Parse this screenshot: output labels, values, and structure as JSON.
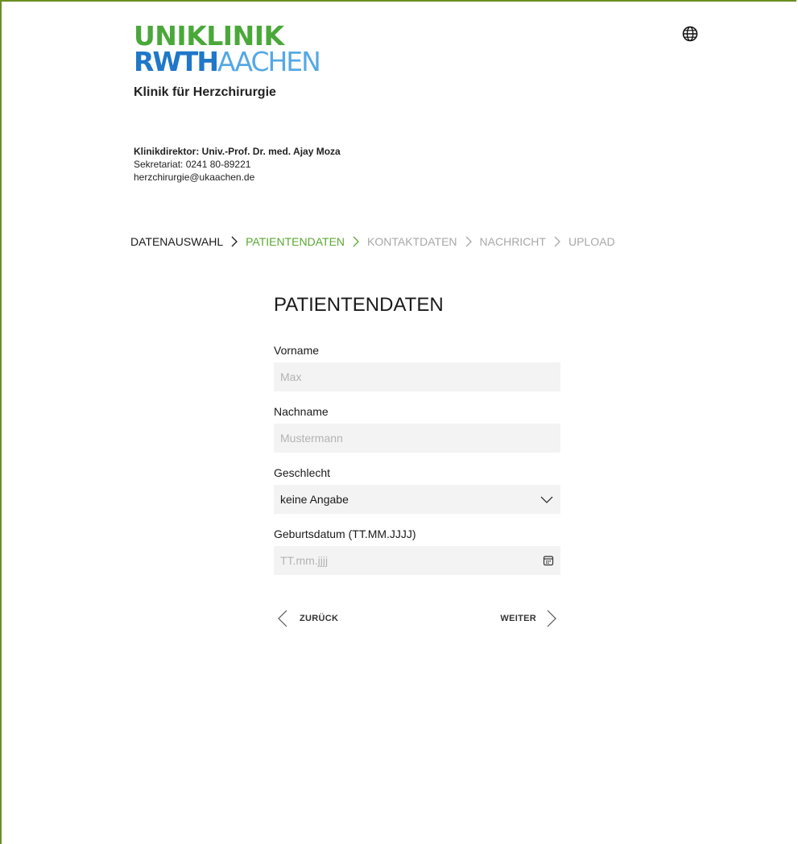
{
  "logo": {
    "line1": "UNIKLINIK",
    "line2_bold": "RWTH",
    "line2_light": "AACHEN",
    "green": "#4aa83a",
    "blue": "#1f78c8",
    "light_blue": "#54a9e3"
  },
  "clinic_name": "Klinik für Herzchirurgie",
  "header": {
    "language_icon": "globe-icon"
  },
  "contact": {
    "director": "Klinikdirektor: Univ.-Prof. Dr. med. Ajay Moza",
    "secretariat": "Sekretariat: 0241 80-89221",
    "email": "herzchirurgie@ukaachen.de"
  },
  "steps": [
    {
      "label": "DATENAUSWAHL",
      "state": "done"
    },
    {
      "label": "PATIENTENDATEN",
      "state": "active"
    },
    {
      "label": "KONTAKTDATEN",
      "state": "pending"
    },
    {
      "label": "NACHRICHT",
      "state": "pending"
    },
    {
      "label": "UPLOAD",
      "state": "pending"
    }
  ],
  "step_colors": {
    "done": "#1a1a1a",
    "active": "#5aa832",
    "pending": "#a8a8a8"
  },
  "form": {
    "title": "PATIENTENDATEN",
    "firstname": {
      "label": "Vorname",
      "placeholder": "Max",
      "value": ""
    },
    "lastname": {
      "label": "Nachname",
      "placeholder": "Mustermann",
      "value": ""
    },
    "gender": {
      "label": "Geschlecht",
      "selected": "keine Angabe"
    },
    "birthdate": {
      "label": "Geburtsdatum (TT.MM.JJJJ)",
      "placeholder": "TT.mm.jjjj"
    },
    "back_label": "ZURÜCK",
    "next_label": "WEITER"
  }
}
